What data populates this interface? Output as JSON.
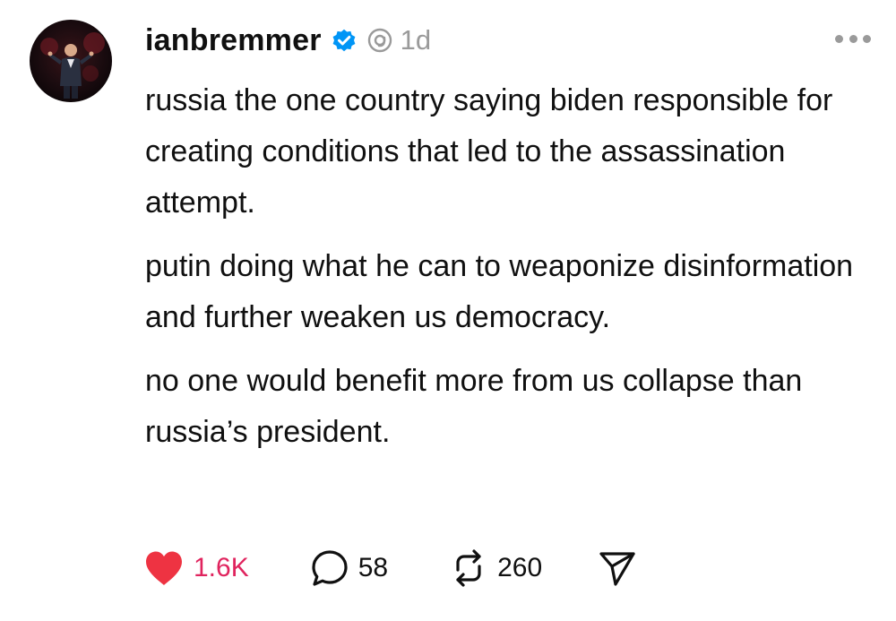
{
  "post": {
    "username": "ianbremmer",
    "timestamp": "1d",
    "paragraphs": [
      "russia the one country saying biden responsible for creating conditions that led to the assassination attempt.",
      "putin doing what he can to weaponize disinformation and further weaken us democracy.",
      "no one would benefit more from us collapse than russia’s president."
    ],
    "likes": "1.6K",
    "replies": "58",
    "reposts": "260"
  },
  "icons": {
    "verified": "verified-badge-icon",
    "thread": "threads-logo-icon",
    "more": "more-dots-icon",
    "like": "heart-icon",
    "reply": "comment-bubble-icon",
    "repost": "repost-arrows-icon",
    "share": "send-icon"
  },
  "colors": {
    "like": "#ee3342",
    "verified": "#0095f6",
    "muted": "#9a9a9a"
  }
}
